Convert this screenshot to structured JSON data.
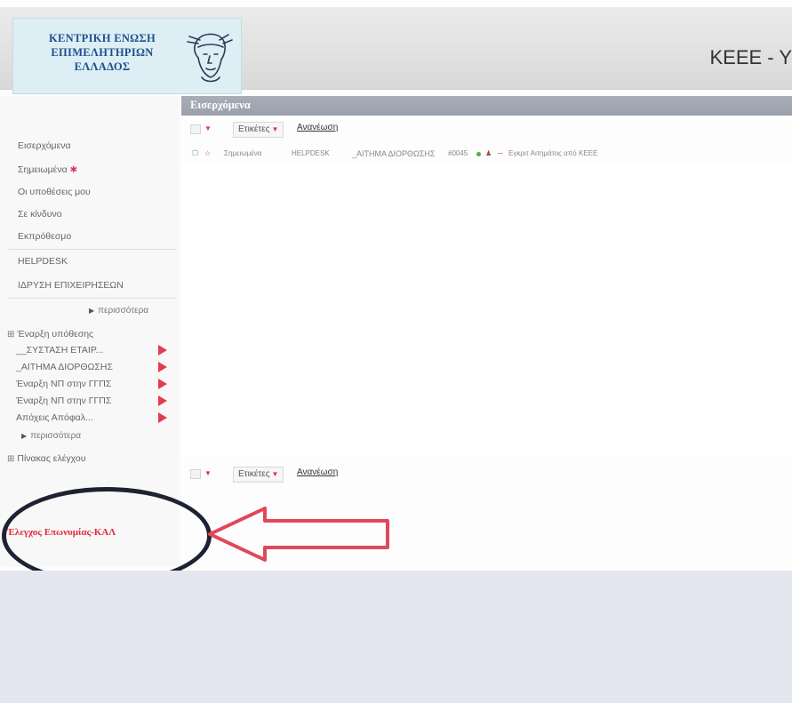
{
  "header": {
    "org_name_line1": "ΚΕΝΤΡΙΚΗ ΕΝΩΣΗ",
    "org_name_line2": "ΕΠΙΜΕΛΗΤΗΡΙΩΝ",
    "org_name_line3": "ΕΛΛΑΔΟΣ",
    "title": "KEEE - Y"
  },
  "sidebar": {
    "items": [
      {
        "label": "Εισερχόμενα"
      },
      {
        "label": "Σημειωμένα"
      },
      {
        "label": "Οι υποθέσεις μου"
      },
      {
        "label": "Σε κίνδυνο"
      },
      {
        "label": "Εκπρόθεσμο"
      },
      {
        "label": "HELPDESK"
      },
      {
        "label": "ΙΔΡΥΣΗ ΕΠΙΧΕΙΡΗΣΕΩΝ"
      }
    ],
    "more_1": "περισσότερα",
    "group_start": "Έναρξη υπόθεσης",
    "sub_items": [
      {
        "label": "__ΣΥΣΤΑΣΗ ΕΤΑΙΡ..."
      },
      {
        "label": "_ΑΙΤΗΜΑ ΔΙΟΡΘΩΣΗΣ"
      },
      {
        "label": "Έναρξη ΝΠ στην ΓΓΠΣ"
      },
      {
        "label": "Έναρξη ΝΠ στην ΓΓΠΣ"
      },
      {
        "label": "Απόχεις Απόφαλ..."
      }
    ],
    "more_2": "περισσότερα",
    "group_control": "Πίνακας ελέγχου",
    "highlight_link": "Έλεγχος Επωνυμίας-ΚΑΛ"
  },
  "main": {
    "title": "Εισερχόμενα",
    "toolbar": {
      "labels_button": "Ετικέτες",
      "refresh_link": "Ανανέωση"
    },
    "message": {
      "folder": "Σημειωμένα",
      "source": "HELPDESK",
      "subject": "_ΑΙΤΗΜΑ ΔΙΟΡΘΩΣΗΣ",
      "id": "#0045",
      "description": "Εγκριτ Αιτημάτος από ΚΕΕΕ"
    }
  },
  "colors": {
    "accent_red": "#e3283c",
    "header_bar": "#9aa0ab",
    "logo_blue": "#1d4f8c",
    "logo_bg": "#ddeef5"
  }
}
